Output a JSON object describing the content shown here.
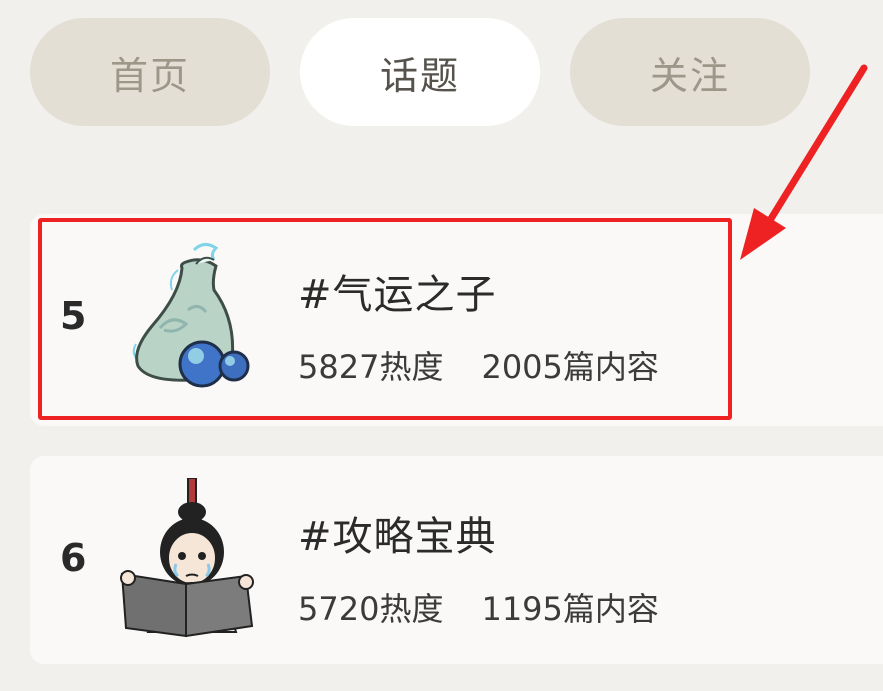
{
  "tabs": {
    "home": "首页",
    "topics": "话题",
    "follow": "关注"
  },
  "topics": [
    {
      "rank": "5",
      "title": "#气运之子",
      "heat": "5827热度",
      "posts": "2005篇内容",
      "image": "vase-icon"
    },
    {
      "rank": "6",
      "title": "#攻略宝典",
      "heat": "5720热度",
      "posts": "1195篇内容",
      "image": "reading-scholar-icon"
    }
  ],
  "colors": {
    "highlight": "#ee2222",
    "active_tab_bg": "#ffffff",
    "inactive_tab_bg": "#e3dfd5"
  }
}
